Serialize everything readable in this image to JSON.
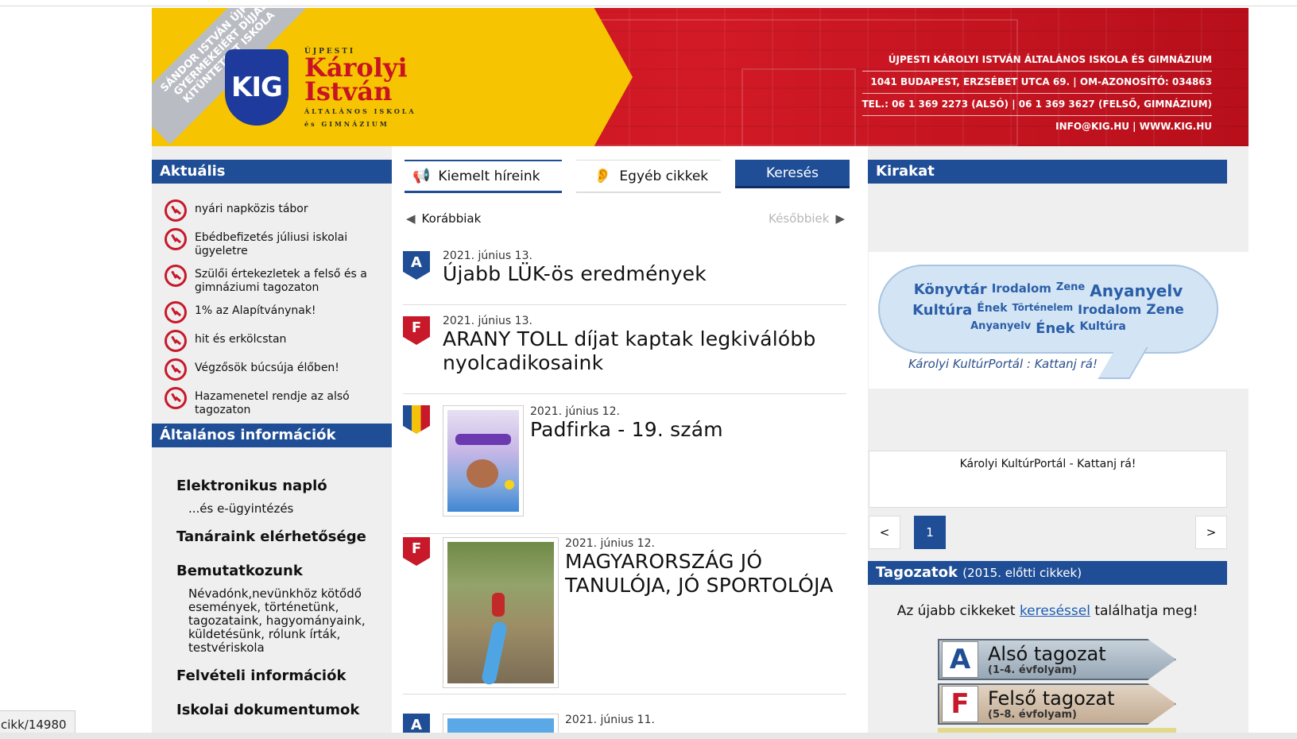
{
  "header": {
    "ribbon_text": "SÁNDOR ISTVÁN ÚJPEST GYERMEKEIÉRT DÍJJAL KITÜNTETETT ISKOLA",
    "logo_abbr": "KIG",
    "logo_top": "ÚJPESTI",
    "logo_name1": "Károlyi",
    "logo_name2": "István",
    "logo_sub1": "ÁLTALÁNOS ISKOLA",
    "logo_sub2": "és GIMNÁZIUM",
    "school_name": "ÚJPESTI KÁROLYI ISTVÁN ÁLTALÁNOS ISKOLA ÉS GIMNÁZIUM",
    "address": "1041 BUDAPEST, ERZSÉBET UTCA 69. | OM-AZONOSÍTÓ: 034863",
    "phones": "TEL.: 06 1 369 2273 (ALSÓ) | 06 1 369 3627 (FELSŐ, GIMNÁZIUM)",
    "web": "INFO@KIG.HU | WWW.KIG.HU"
  },
  "left": {
    "aktualis_title": "Aktuális",
    "news": [
      "nyári napközis tábor",
      "Ebédbefizetés júliusi iskolai ügyeletre",
      "Szülői értekezletek a felső és a gimnáziumi tagozaton",
      "1% az Alapítványnak!",
      "hit és erkölcstan",
      "Végzősök búcsúja élőben!",
      "Hazamenetel rendje az alsó tagozaton"
    ],
    "info_title": "Általános információk",
    "info": {
      "enaplo": "Elektronikus napló",
      "enaplo_sub": "...és e-ügyintézés",
      "tanarok": "Tanáraink elérhetősége",
      "bemutat": "Bemutatkozunk",
      "bemutat_sub": "Névadónk,nevünkhöz kötődő események, történetünk, tagozataink, hagyományaink, küldetésünk, rólunk írták, testvériskola",
      "felveteli": "Felvételi információk",
      "dokumentumok": "Iskolai dokumentumok"
    }
  },
  "middle": {
    "tabs": {
      "kiemelt": "Kiemelt híreink",
      "egyeb": "Egyéb cikkek",
      "kereses": "Keresés"
    },
    "prev": "Korábbiak",
    "next": "Későbbiek",
    "articles": [
      {
        "badge": "A",
        "date": "2021. június 13.",
        "title": "Újabb LÜK-ös eredmények"
      },
      {
        "badge": "F",
        "date": "2021. június 13.",
        "title": "ARANY TOLL díjat kaptak legkiválóbb nyolcadikosaink"
      },
      {
        "badge": "",
        "date": "2021. június 12.",
        "title": "Padfirka - 19. szám"
      },
      {
        "badge": "F",
        "date": "2021. június 12.",
        "title": "MAGYARORSZÁG JÓ TANULÓJA, JÓ SPORTOLÓJA"
      },
      {
        "badge": "A",
        "date": "2021. június 11.",
        "title": ""
      }
    ]
  },
  "right": {
    "kirakat_title": "Kirakat",
    "cloud_words": [
      "Könyvtár",
      "Irodalom",
      "Zene",
      "Anyanyelv",
      "Kultúra",
      "Ének",
      "Történelem",
      "Irodalom",
      "Zene",
      "Anyanyelv",
      "Ének",
      "Kultúra"
    ],
    "cloud_caption": "Károlyi KultúrPortál : Kattanj rá!",
    "card_text": "Károlyi KultúrPortál - Kattanj rá!",
    "pager": {
      "prev": "<",
      "page": "1",
      "next": ">"
    },
    "tagozat_title": "Tagozatok",
    "tagozat_sub": "(2015. előtti cikkek)",
    "note_before": "Az újabb cikkeket ",
    "note_link": "kereséssel",
    "note_after": " találhatja meg!",
    "also": {
      "letter": "A",
      "name": "Alsó tagozat",
      "years": "(1-4. évfolyam)"
    },
    "felso": {
      "letter": "F",
      "name": "Felső tagozat",
      "years": "(5-8. évfolyam)"
    }
  },
  "status": {
    "url": "cikk/14980"
  },
  "colors": {
    "brand_blue": "#1f4e96",
    "brand_red": "#c7192a",
    "brand_yellow": "#f6c401"
  }
}
